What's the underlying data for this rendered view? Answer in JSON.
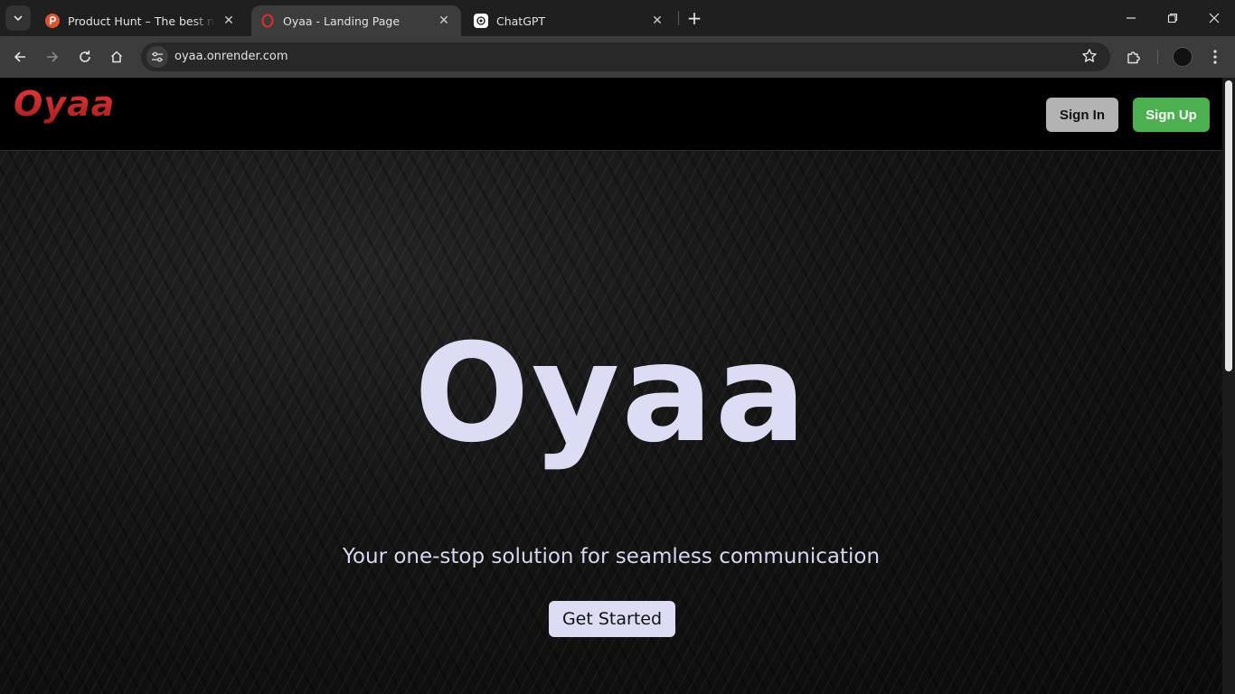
{
  "browser": {
    "tabs": [
      {
        "title": "Product Hunt – The best new products in tech.",
        "favicon": "product-hunt-favicon",
        "color": "#da552f",
        "active": false
      },
      {
        "title": "Oyaa - Landing Page",
        "favicon": "oyaa-favicon",
        "color": "#d32f2f",
        "active": true
      },
      {
        "title": "ChatGPT",
        "favicon": "chatgpt-favicon",
        "color": "#ffffff",
        "active": false
      }
    ],
    "address": "oyaa.onrender.com"
  },
  "nav": {
    "logo": "Oyaa",
    "signin_label": "Sign In",
    "signup_label": "Sign Up"
  },
  "hero": {
    "title": "Oyaa",
    "subtitle": "Your one-stop solution for seamless communication",
    "cta_label": "Get Started"
  },
  "colors": {
    "brand_red": "#d32f2f",
    "signup_green": "#4caf50",
    "hero_text": "#dcdcf5"
  }
}
